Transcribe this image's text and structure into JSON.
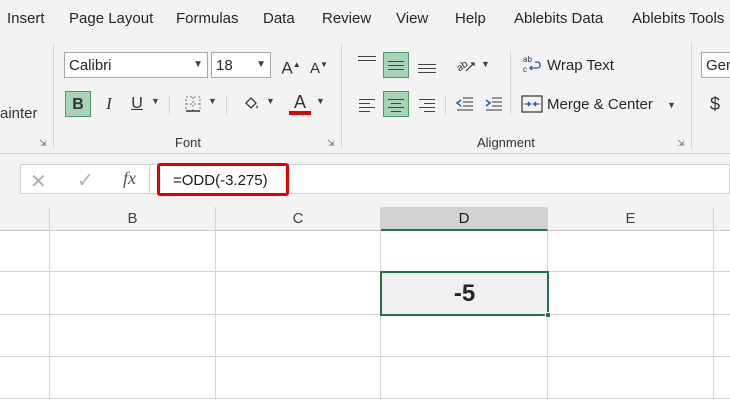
{
  "menu": {
    "tabs": [
      "Insert",
      "Page Layout",
      "Formulas",
      "Data",
      "Review",
      "View",
      "Help",
      "Ablebits Data",
      "Ablebits Tools"
    ]
  },
  "ribbon": {
    "clipboard_partial_label": "ainter",
    "font": {
      "name": "Calibri",
      "size": "18",
      "group_label": "Font"
    },
    "alignment": {
      "wrap_text": "Wrap Text",
      "merge_center": "Merge & Center",
      "group_label": "Alignment"
    },
    "number": {
      "format_partial": "Gen",
      "currency_symbol": "$"
    }
  },
  "formula_bar": {
    "fx_label": "fx",
    "formula": "=ODD(-3.275)"
  },
  "grid": {
    "columns": [
      "B",
      "C",
      "D",
      "E"
    ],
    "selected_column": "D",
    "active_cell_value": "-5"
  },
  "colors": {
    "accent": "#217346",
    "highlight_box": "#e00000",
    "font_color_bar": "#e00000",
    "selected_button": "#a9d3b9"
  },
  "icons": [
    "increase-font-icon",
    "decrease-font-icon",
    "borders-icon",
    "fill-color-icon",
    "font-color-icon",
    "text-orientation-icon",
    "wrap-text-icon",
    "merge-center-icon",
    "cancel-icon",
    "enter-icon"
  ]
}
